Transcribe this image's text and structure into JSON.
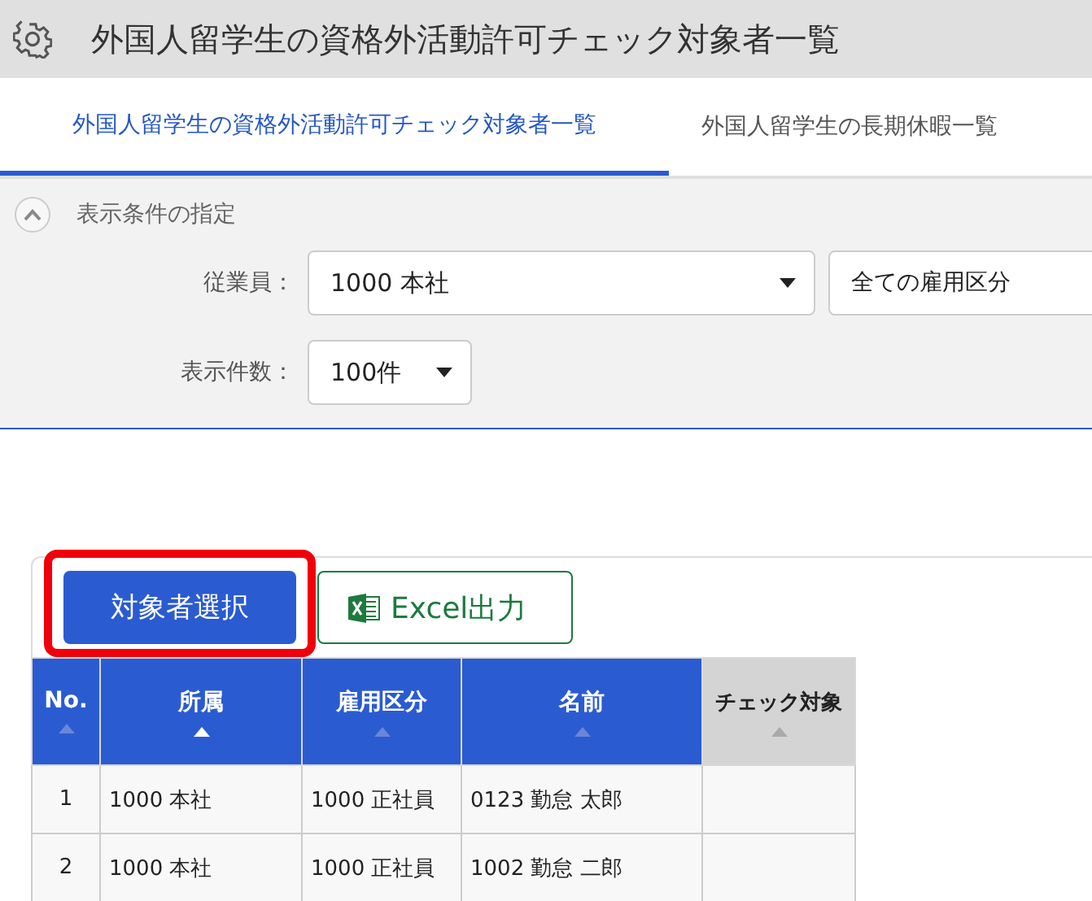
{
  "header": {
    "title": "外国人留学生の資格外活動許可チェック対象者一覧"
  },
  "tabs": [
    {
      "label": "外国人留学生の資格外活動許可チェック対象者一覧",
      "selected": true
    },
    {
      "label": "外国人留学生の長期休暇一覧",
      "selected": false
    }
  ],
  "filter": {
    "title": "表示条件の指定",
    "expanded": true,
    "employee": {
      "label": "従業員：",
      "value": "1000 本社",
      "category": "全ての雇用区分"
    },
    "count": {
      "label": "表示件数：",
      "value": "100件"
    }
  },
  "buttons": [
    {
      "kind": "primary",
      "label": "対象者選択",
      "highlighted": true
    },
    {
      "kind": "excel",
      "label": "Excel出力",
      "highlighted": false
    }
  ],
  "table": {
    "columns": [
      {
        "label": "No.",
        "kind": "sortable",
        "sorted": false
      },
      {
        "label": "所属",
        "kind": "sortable",
        "sorted": true
      },
      {
        "label": "雇用区分",
        "kind": "sortable",
        "sorted": false
      },
      {
        "label": "名前",
        "kind": "sortable",
        "sorted": false
      },
      {
        "label": "チェック対象",
        "kind": "plain",
        "sorted": false
      }
    ],
    "rows": [
      [
        "1",
        "1000 本社",
        "1000 正社員",
        "0123 勤怠 太郎",
        ""
      ],
      [
        "2",
        "1000 本社",
        "1000 正社員",
        "1002 勤怠 二郎",
        ""
      ]
    ]
  }
}
